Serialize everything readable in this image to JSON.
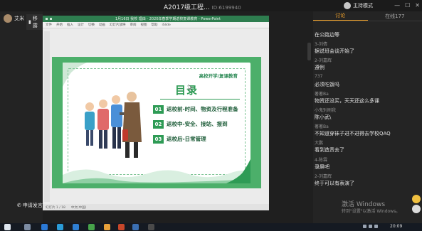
{
  "window": {
    "title": "A2017级工程...",
    "room_id": "ID:6199940",
    "host_name": "主持模式"
  },
  "left": {
    "user_name": "艾米",
    "tool_label": "移露",
    "apply_label": "申请发言"
  },
  "ppt": {
    "doc_title": "1月16日 我校 理由 - 2020年春季学期返校复课教育 - PowerPoint",
    "ribbon": [
      "文件",
      "开始",
      "插入",
      "设计",
      "切换",
      "动画",
      "幻灯片放映",
      "审阅",
      "视图",
      "帮助",
      "iSlide"
    ],
    "status": [
      "幻灯片 1 / 18",
      "中文(中国)"
    ],
    "slide": {
      "subtitle": "高校开学/复课教育",
      "title": "目录",
      "items": [
        {
          "num": "01",
          "text": "返校前-时间、物资及行程准备"
        },
        {
          "num": "02",
          "text": "返校中-安全、接站、报到"
        },
        {
          "num": "03",
          "text": "返校后-日常管理"
        }
      ]
    }
  },
  "right": {
    "tabs": [
      {
        "label": "讨论",
        "active": true
      },
      {
        "label": "在线177",
        "active": false
      }
    ],
    "messages": [
      {
        "name": "",
        "text": "在公路边等"
      },
      {
        "name": "3-刘倩",
        "text": "据说班会谈开始了"
      },
      {
        "name": "2-刘嘉辉",
        "text": "遵例"
      },
      {
        "name": "737",
        "text": "必须吃饭吗"
      },
      {
        "name": "著著Ba",
        "text": "物资还没买，天天还这么多课"
      },
      {
        "name": "小鬼别刷我",
        "text": "陈小武\\"
      },
      {
        "name": "著著Ba",
        "text": "不知道穿袜子进不进得去学校QAQ"
      },
      {
        "name": "大鹏",
        "text": "看到造责去了"
      },
      {
        "name": "4-陈霖",
        "text": "录屏吧"
      },
      {
        "name": "2-刘嘉辉",
        "text": "终于可以有表演了"
      }
    ],
    "watermark": "激活 Windows",
    "watermark_sub": "转到\"设置\"以激活 Windows。"
  },
  "taskbar": {
    "time": "20:09"
  }
}
